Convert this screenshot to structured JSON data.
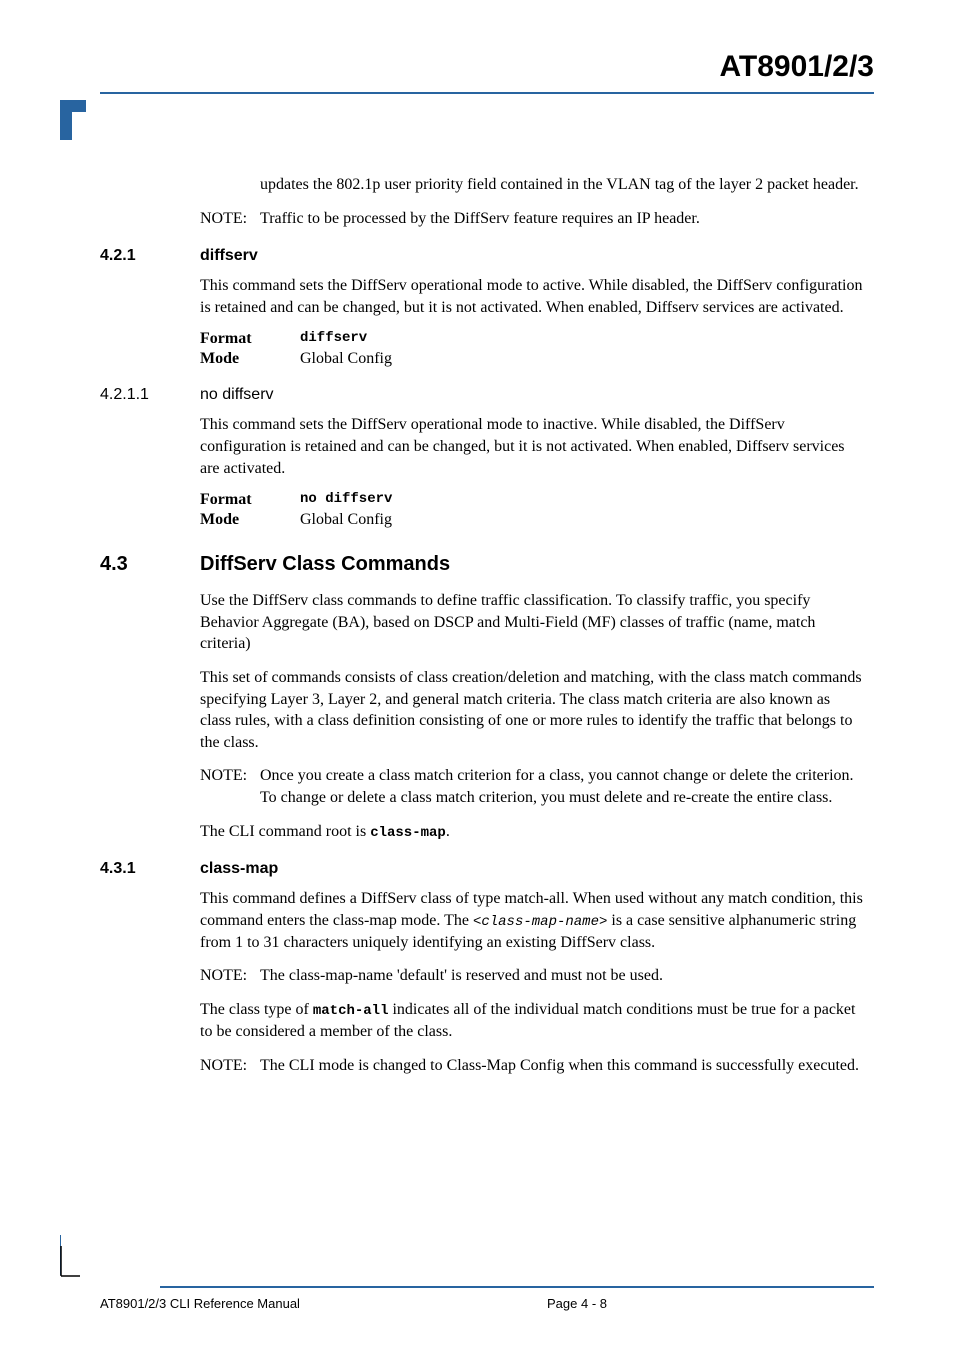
{
  "header": {
    "title": "AT8901/2/3"
  },
  "intro": {
    "continuation": "updates the 802.1p user priority field contained in the VLAN tag of the layer 2 packet header.",
    "note_label": "NOTE:",
    "note_text": "Traffic to be processed by the DiffServ feature requires an IP header."
  },
  "s421": {
    "num": "4.2.1",
    "title": "diffserv",
    "body": "This command sets the DiffServ operational mode to active. While disabled, the DiffServ configuration is retained and can be changed, but it is not activated. When enabled, Diffserv services are activated.",
    "format_label": "Format",
    "format_value": "diffserv",
    "mode_label": "Mode",
    "mode_value": "Global Config"
  },
  "s4211": {
    "num": "4.2.1.1",
    "title": "no diffserv",
    "body": "This command sets the DiffServ operational mode to inactive. While disabled, the DiffServ configuration is retained and can be changed, but it is not activated. When enabled, Diffserv services are activated.",
    "format_label": "Format",
    "format_value": "no diffserv",
    "mode_label": "Mode",
    "mode_value": "Global Config"
  },
  "s43": {
    "num": "4.3",
    "title": "DiffServ Class Commands",
    "p1": "Use the DiffServ class commands to define traffic classification. To classify traffic, you specify Behavior Aggregate (BA), based on DSCP and Multi-Field (MF) classes of traffic (name, match criteria)",
    "p2": "This set of commands consists of class creation/deletion and matching, with the class match commands specifying Layer 3, Layer 2, and general match criteria. The class match criteria are also known as class rules, with a class definition consisting of one or more rules to identify the traffic that belongs to the class.",
    "note_label": "NOTE:",
    "note_text": "Once you create a class match criterion for a class, you cannot change or delete the criterion. To change or delete a class match criterion, you must delete and re-create the entire class.",
    "p3a": "The CLI command root is ",
    "p3b": "class-map",
    "p3c": "."
  },
  "s431": {
    "num": "4.3.1",
    "title": "class-map",
    "p1a": "This command defines a DiffServ class of type match-all. When used without any match condition, this command enters the class-map mode. The ",
    "p1b": "<class-map-name>",
    "p1c": " is a case sensitive alphanumeric string from 1 to 31 characters uniquely identifying an existing DiffServ class.",
    "note1_label": "NOTE:",
    "note1_text": "The class-map-name 'default' is reserved and must not be used.",
    "p2a": "The class type of ",
    "p2b": "match-all",
    "p2c": "  indicates all of the individual match conditions must be true for a packet to be considered a member of the class.",
    "note2_label": "NOTE:",
    "note2_text": "The CLI mode is changed to Class-Map Config when this command is successfully executed."
  },
  "footer": {
    "left": "AT8901/2/3 CLI Reference Manual",
    "center": "Page 4 - 8"
  }
}
